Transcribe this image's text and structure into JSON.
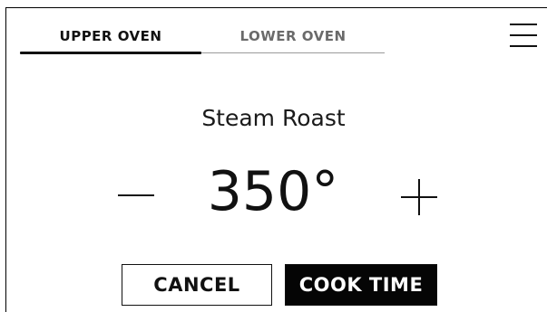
{
  "tabs": [
    {
      "label": "UPPER OVEN",
      "active": true
    },
    {
      "label": "LOWER OVEN",
      "active": false
    }
  ],
  "menu": {
    "icon": "hamburger-menu-icon"
  },
  "mode": {
    "title": "Steam Roast"
  },
  "temperature": {
    "value": "350°"
  },
  "controls": {
    "decrease_icon": "minus-icon",
    "increase_icon": "plus-icon"
  },
  "actions": {
    "cancel_label": "CANCEL",
    "cook_time_label": "COOK TIME"
  },
  "colors": {
    "text": "#111111",
    "inactive_tab": "#6a6a6a",
    "primary_button_bg": "#050505",
    "primary_button_text": "#ffffff",
    "background": "#ffffff"
  }
}
